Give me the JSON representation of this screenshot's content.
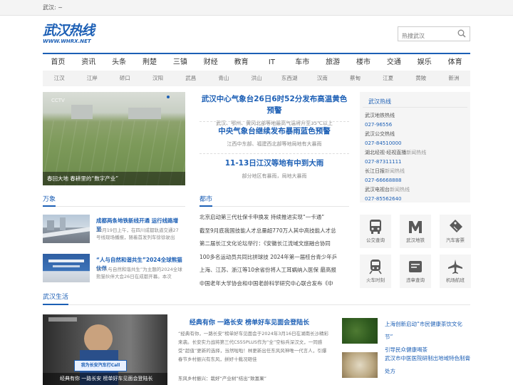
{
  "topbar": {
    "text": "武汉:  ~"
  },
  "logo": {
    "cn": "武汉热线",
    "en": "WWW.WHRX.NET"
  },
  "search": {
    "placeholder": "热搜武汉"
  },
  "nav": [
    "首页",
    "资讯",
    "头条",
    "荆楚",
    "三镇",
    "财经",
    "教育",
    "IT",
    "车市",
    "旅游",
    "楼市",
    "交通",
    "娱乐",
    "体育"
  ],
  "subnav": [
    "江汉",
    "江岸",
    "硚口",
    "汉阳",
    "武昌",
    "青山",
    "洪山",
    "东西湖",
    "汉南",
    "蔡甸",
    "江夏",
    "黄陂",
    "新洲"
  ],
  "hero": {
    "caption": "春回大地 春耕里的“数字产业”",
    "logo": "CCTV"
  },
  "headlines": [
    {
      "title": "武汉中心气象台26日6时52分发布高温黄色预警",
      "sub": "武汉、鄂州、黄冈北部等地最高气温将升至35℃以上"
    },
    {
      "title": "中央气象台继续发布暴雨蓝色预警",
      "sub": "江西中东部、福建西北部等地局地有大暴雨"
    },
    {
      "title": "11-13日江汉等地有中到大雨",
      "sub": "部分地区有暴雨，局地大暴雨"
    }
  ],
  "sections": {
    "wanxiang": "万象",
    "dushi": "都市",
    "life": "武汉生活"
  },
  "hotline": {
    "title": "武汉热线",
    "rows": [
      {
        "name": "武汉地铁热线",
        "phone": "027-96556"
      },
      {
        "name": "武汉公交热线",
        "phone": "027-84510000"
      },
      {
        "name": "湖北经视·经视直播",
        "suffix": "新闻热线",
        "phone": "027-87311111"
      },
      {
        "name": "长江日报",
        "suffix": "新闻热线",
        "phone": "027-66668888"
      },
      {
        "name": "武汉电视台",
        "suffix": "新闻热线",
        "phone": "027-85562640"
      }
    ]
  },
  "services": [
    {
      "icon": "bus-icon",
      "label": "公交查询"
    },
    {
      "icon": "metro-icon",
      "label": "武汉地铁"
    },
    {
      "icon": "ticket-icon",
      "label": "汽车客票"
    },
    {
      "icon": "train-icon",
      "label": "火车时刻"
    },
    {
      "icon": "violation-icon",
      "label": "违章查询"
    },
    {
      "icon": "plane-icon",
      "label": "机场航班"
    }
  ],
  "wanxiang_news": [
    {
      "title": "成都两条地铁新线开通 运行线路增至",
      "summary": "12月19日上午，在四川成都轨道交通27号线现场播报，随着首发列车徐徐驶出"
    },
    {
      "title": "“人与自然和谐共生”2024全球熊猫伙伴",
      "summary": "以“人与自然和谐共生”为主题的2024全球熊猫伙伴大会26日在成都开幕。本次"
    }
  ],
  "dushi_lines": [
    "北京启动第三代社保卡申换发 持续推进实现“一卡通”",
    "截至9月底我国技能人才总量超770万人其中高技能人才总",
    "第二届长江文化论坛举行：《安徽长江流域文旅融合协同",
    "100多名运动员共同比拼球技 2024年第一届桂台青少年乒",
    "上海、江苏、浙江等10余省份将人工耳蜗纳入医保 最高报",
    "中国老年大学协会和中国老龄科学研究中心联合发布《中"
  ],
  "life": {
    "caption": "经典有你 一路长安 榜单好车见面会登陆长",
    "title": "经典有你 一路长安 榜单好车见面会登陆长",
    "text": "“经典有你，一路长安”榜单好车见面会于2024年3月16日在湖南长沙精彩来袭。长安实力战将第三代CS55PLUS作为“全”空标兵深汉文，一同感受“超值”更新的选择，当然啦啦！林更新出任东风风神唯一代言人，引爆春节乡村振兴有东风，拼好十载况砸佳",
    "line1": "东风乡村振兴：栽好“产业树”结出“致富果”",
    "banner": "我为长安汽车打Call"
  },
  "side_news": [
    {
      "title1": "上海创新启动“市民健康茶饮文化节”",
      "title2": "引导民众健康喝茶"
    },
    {
      "title1": "武汉市中医医院研制出地域特色制膏",
      "title2": "处方"
    }
  ]
}
